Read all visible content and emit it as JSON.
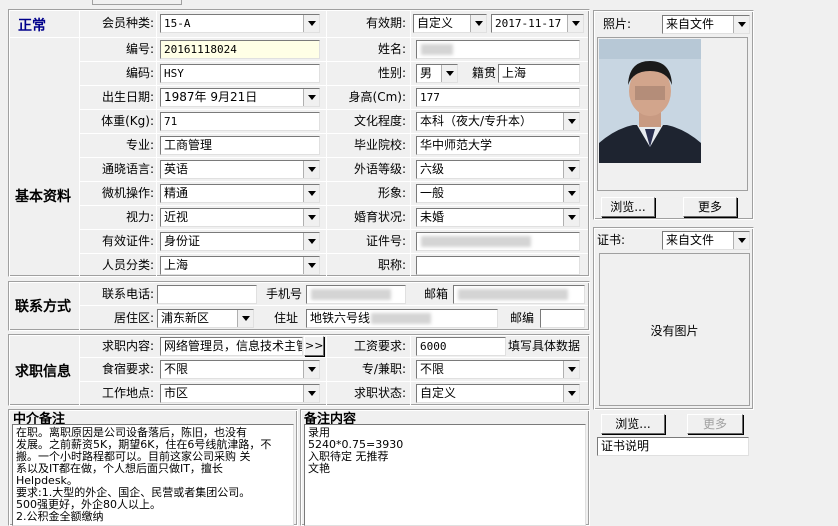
{
  "tab": {
    "label": "基本资料"
  },
  "status": {
    "label": "正常"
  },
  "member": {
    "type_label": "会员种类:",
    "type_value": "15-A",
    "valid_label": "有效期:",
    "valid_mode": "自定义",
    "valid_date": "2017-11-17"
  },
  "basic": {
    "section_title": "基本资料",
    "number_label": "编号:",
    "number_value": "20161118024",
    "name_label": "姓名:",
    "code_label": "编码:",
    "code_value": "HSY",
    "gender_label": "性别:",
    "gender_value": "男",
    "origin_label": "籍贯",
    "origin_value": "上海",
    "birth_label": "出生日期:",
    "birth_value": "1987年 9月21日",
    "height_label": "身高(Cm):",
    "height_value": "177",
    "weight_label": "体重(Kg):",
    "weight_value": "71",
    "education_label": "文化程度:",
    "education_value": "本科（夜大/专升本）",
    "major_label": "专业:",
    "major_value": "工商管理",
    "school_label": "毕业院校:",
    "school_value": "华中师范大学",
    "language_label": "通晓语言:",
    "language_value": "英语",
    "lang_level_label": "外语等级:",
    "lang_level_value": "六级",
    "computer_label": "微机操作:",
    "computer_value": "精通",
    "appearance_label": "形象:",
    "appearance_value": "一般",
    "vision_label": "视力:",
    "vision_value": "近视",
    "marital_label": "婚育状况:",
    "marital_value": "未婚",
    "id_type_label": "有效证件:",
    "id_type_value": "身份证",
    "id_no_label": "证件号:",
    "category_label": "人员分类:",
    "category_value": "上海",
    "title_label": "职称:"
  },
  "contact": {
    "section_title": "联系方式",
    "phone_label": "联系电话:",
    "mobile_label": "手机号",
    "email_label": "邮箱",
    "district_label": "居住区:",
    "district_value": "浦东新区",
    "address_label": "住址",
    "address_value": "地铁六号线",
    "postcode_label": "邮编"
  },
  "job": {
    "section_title": "求职信息",
    "content_label": "求职内容:",
    "content_value": "网络管理员，信息技术主管",
    "more_btn": ">>",
    "salary_label": "工资要求:",
    "salary_value": "6000",
    "salary_hint": "填写具体数据",
    "board_label": "食宿要求:",
    "board_value": "不限",
    "parttime_label": "专/兼职:",
    "parttime_value": "不限",
    "location_label": "工作地点:",
    "location_value": "市区",
    "state_label": "求职状态:",
    "state_value": "自定义"
  },
  "agency_notes": {
    "title": "中介备注",
    "lines": [
      "在职。离职原因是公司设备落后，陈旧，也没有",
      "发展。之前薪资5K，期望6K，住在6号线航津路，不",
      "搬。一个小时路程都可以。目前这家公司采购 关",
      "系以及IT都在做，个人想后面只做IT，擅长",
      "Helpdesk。",
      "要求:1.大型的外企、国企、民营或者集团公司。",
      "500强更好，外企80人以上。",
      "2.公积金全额缴纳"
    ]
  },
  "remarks": {
    "title": "备注内容",
    "lines": [
      "   录用",
      "5240*0.75=3930",
      "入职待定   无推荐",
      "文艳"
    ]
  },
  "photo": {
    "label": "照片:",
    "source": "来自文件",
    "browse": "浏览...",
    "more": "更多"
  },
  "certificate": {
    "label": "证书:",
    "source": "来自文件",
    "empty": "没有图片",
    "browse": "浏览...",
    "more": "更多",
    "desc": "证书说明"
  }
}
